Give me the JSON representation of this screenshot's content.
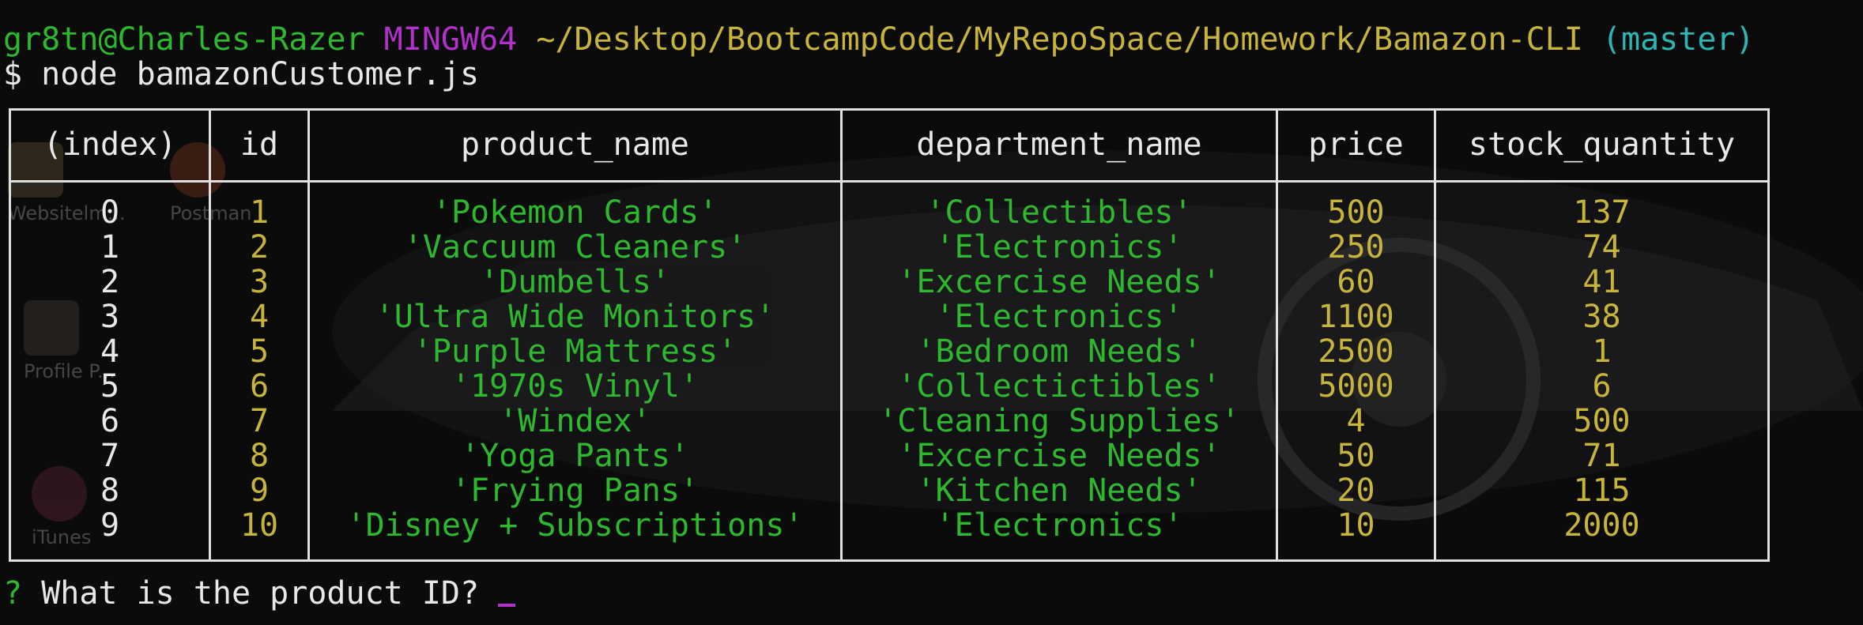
{
  "prompt_line": {
    "user": "gr8tn@Charles-Razer",
    "env": "MINGW64",
    "path": "~/Desktop/BootcampCode/MyRepoSpace/Homework/Bamazon-CLI",
    "branch": "(master)"
  },
  "command_line": "$ node bamazonCustomer.js",
  "desktop_icons": [
    "Websitelm...",
    "Postman",
    "Profile P...",
    "iTunes"
  ],
  "table": {
    "headers": [
      "(index)",
      "id",
      "product_name",
      "department_name",
      "price",
      "stock_quantity"
    ],
    "rows": [
      {
        "index": "0",
        "id": "1",
        "product": "'Pokemon Cards'",
        "dept": "'Collectibles'",
        "price": "500",
        "stock": "137"
      },
      {
        "index": "1",
        "id": "2",
        "product": "'Vaccuum Cleaners'",
        "dept": "'Electronics'",
        "price": "250",
        "stock": "74"
      },
      {
        "index": "2",
        "id": "3",
        "product": "'Dumbells'",
        "dept": "'Excercise Needs'",
        "price": "60",
        "stock": "41"
      },
      {
        "index": "3",
        "id": "4",
        "product": "'Ultra Wide Monitors'",
        "dept": "'Electronics'",
        "price": "1100",
        "stock": "38"
      },
      {
        "index": "4",
        "id": "5",
        "product": "'Purple Mattress'",
        "dept": "'Bedroom Needs'",
        "price": "2500",
        "stock": "1"
      },
      {
        "index": "5",
        "id": "6",
        "product": "'1970s Vinyl'",
        "dept": "'Collectictibles'",
        "price": "5000",
        "stock": "6"
      },
      {
        "index": "6",
        "id": "7",
        "product": "'Windex'",
        "dept": "'Cleaning Supplies'",
        "price": "4",
        "stock": "500"
      },
      {
        "index": "7",
        "id": "8",
        "product": "'Yoga Pants'",
        "dept": "'Excercise Needs'",
        "price": "50",
        "stock": "71"
      },
      {
        "index": "8",
        "id": "9",
        "product": "'Frying Pans'",
        "dept": "'Kitchen Needs'",
        "price": "20",
        "stock": "115"
      },
      {
        "index": "9",
        "id": "10",
        "product": "'Disney + Subscriptions'",
        "dept": "'Electronics'",
        "price": "10",
        "stock": "2000"
      }
    ]
  },
  "question": {
    "marker": "?",
    "text": "What is the product ID?"
  },
  "colors": {
    "green": "#2eb82e",
    "magenta": "#b032c9",
    "yellow": "#c8b43c",
    "cyan": "#2eb5b5",
    "white": "#e8e8e8"
  }
}
